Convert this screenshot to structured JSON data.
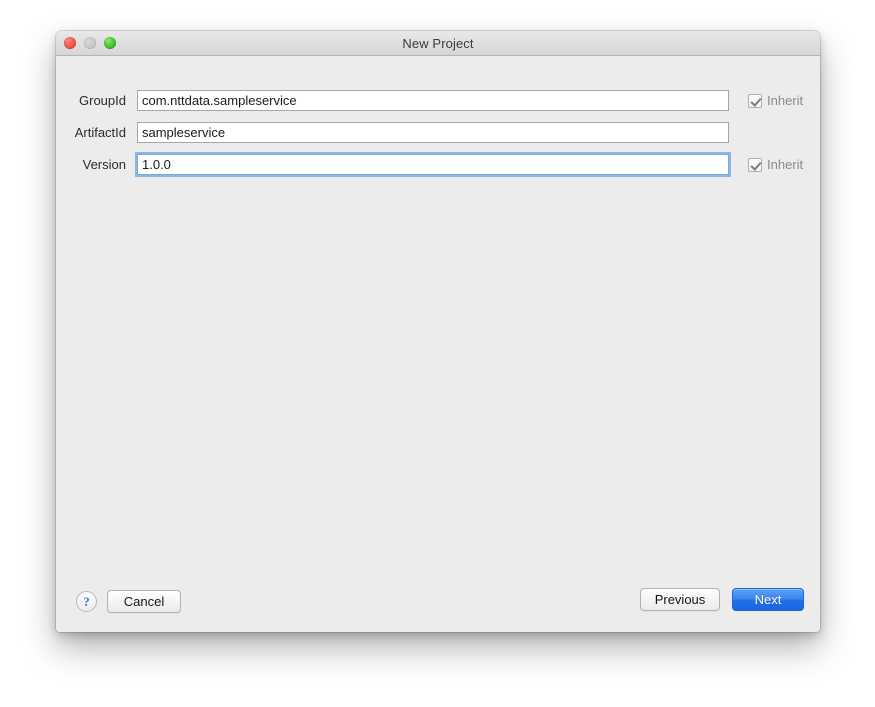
{
  "window": {
    "title": "New Project",
    "traffic_lights": [
      {
        "name": "close",
        "color": "#f0534a"
      },
      {
        "name": "minimize",
        "color": "#c6c6c6"
      },
      {
        "name": "zoom",
        "color": "#3fc22c"
      }
    ]
  },
  "form": {
    "fields": [
      {
        "label": "GroupId",
        "value": "com.nttdata.sampleservice",
        "placeholder": "",
        "focused": false,
        "inherit": {
          "visible": true,
          "checked": true,
          "label": "Inherit"
        }
      },
      {
        "label": "ArtifactId",
        "value": "sampleservice",
        "placeholder": "",
        "focused": false,
        "inherit": {
          "visible": false,
          "checked": false,
          "label": "Inherit"
        }
      },
      {
        "label": "Version",
        "value": "1.0.0",
        "placeholder": "",
        "focused": true,
        "inherit": {
          "visible": true,
          "checked": true,
          "label": "Inherit"
        }
      }
    ]
  },
  "footer": {
    "help_label": "?",
    "cancel_label": "Cancel",
    "previous_label": "Previous",
    "next_label": "Next",
    "next_accent_color": "#2370e9"
  }
}
